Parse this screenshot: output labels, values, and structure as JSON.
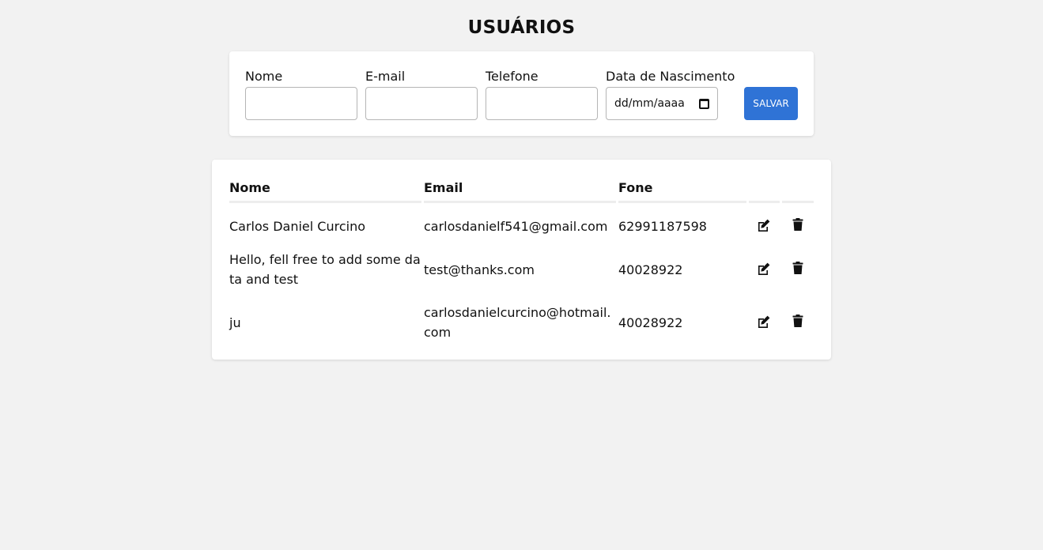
{
  "page": {
    "title": "USUÁRIOS"
  },
  "form": {
    "fields": [
      {
        "label": "Nome",
        "value": ""
      },
      {
        "label": "E-mail",
        "value": ""
      },
      {
        "label": "Telefone",
        "value": ""
      },
      {
        "label": "Data de Nascimento",
        "value": "",
        "placeholder": "dd/mm/aaaa"
      }
    ],
    "save_label": "SALVAR",
    "save_color": "#2f73d6"
  },
  "table": {
    "headers": [
      "Nome",
      "Email",
      "Fone",
      "",
      ""
    ],
    "rows": [
      {
        "nome": "Carlos Daniel Curcino",
        "email": "carlosdanielf541@gmail.com",
        "fone": "62991187598"
      },
      {
        "nome": "Hello, fell free to add some data and test",
        "email": "test@thanks.com",
        "fone": "40028922"
      },
      {
        "nome": "ju",
        "email": "carlosdanielcurcino@hotmail.com",
        "fone": "40028922"
      }
    ],
    "row_actions": [
      "edit-icon",
      "trash-icon"
    ]
  }
}
